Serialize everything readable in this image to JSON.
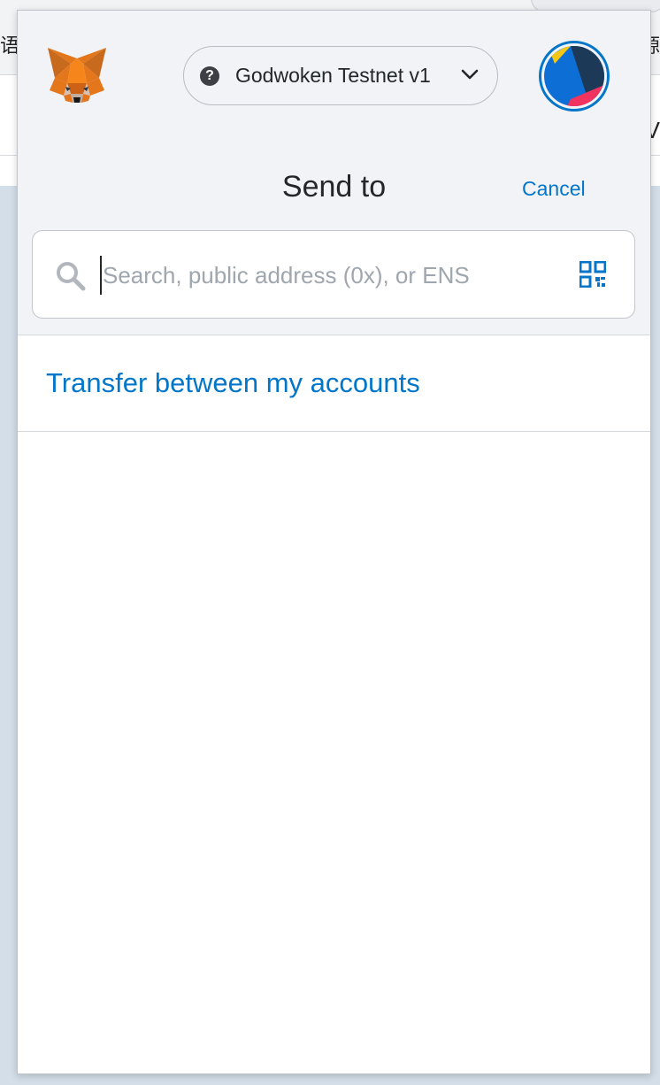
{
  "background": {
    "left_text": "语中",
    "right_text": "源",
    "right_text2": "V"
  },
  "header": {
    "network": {
      "label": "Godwoken Testnet v1",
      "icon": "question-mark-icon"
    },
    "account_avatar": "account-avatar"
  },
  "send": {
    "title": "Send to",
    "cancel_label": "Cancel",
    "search": {
      "value": "",
      "placeholder": "Search, public address (0x), or ENS"
    },
    "transfer_label": "Transfer between my accounts"
  },
  "colors": {
    "accent": "#0376c9",
    "header_bg": "#f1f3f6",
    "text": "#24272a"
  }
}
